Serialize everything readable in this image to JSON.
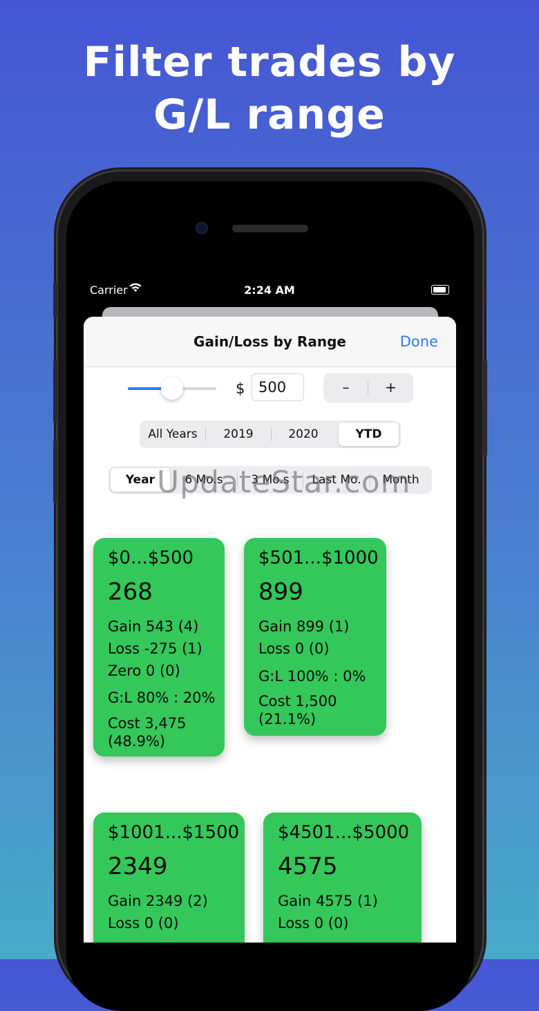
{
  "promo": {
    "headline_line1": "Filter trades by",
    "headline_line2": "G/L range"
  },
  "status_bar": {
    "carrier": "Carrier",
    "time": "2:24 AM"
  },
  "nav": {
    "title": "Gain/Loss by Range",
    "done": "Done"
  },
  "range_control": {
    "slider_value_fraction": 0.5,
    "currency_symbol": "$",
    "amount": "500",
    "minus": "–",
    "plus": "+"
  },
  "year_filter": {
    "items": [
      "All Years",
      "2019",
      "2020",
      "YTD"
    ],
    "selected": "YTD"
  },
  "period_filter": {
    "items": [
      "Year",
      "6 Mo.s",
      "3 Mo.s",
      "Last Mo.",
      "Month"
    ],
    "selected": "Year"
  },
  "watermark": "UpdateStar.com",
  "cards": [
    {
      "range": "$0...$500",
      "total": "268",
      "gain": "Gain 543 (4)",
      "loss": "Loss -275 (1)",
      "zero": "Zero 0 (0)",
      "ratio": "G:L 80% : 20%",
      "cost": "Cost 3,475",
      "cost_pct": "(48.9%)"
    },
    {
      "range": "$501...$1000",
      "total": "899",
      "gain": "Gain 899 (1)",
      "loss": "Loss 0 (0)",
      "ratio": "G:L 100% : 0%",
      "cost": "Cost 1,500",
      "cost_pct": "(21.1%)"
    },
    {
      "range": "$1001...$1500",
      "total": "2349",
      "gain": "Gain 2349 (2)",
      "loss": "Loss 0 (0)"
    },
    {
      "range": "$4501...$5000",
      "total": "4575",
      "gain": "Gain 4575 (1)",
      "loss": "Loss 0 (0)"
    }
  ],
  "colors": {
    "card_green": "#34c759",
    "accent_blue": "#2b7cf6",
    "bg_top": "#4656d3",
    "bg_bottom": "#49aac9"
  }
}
